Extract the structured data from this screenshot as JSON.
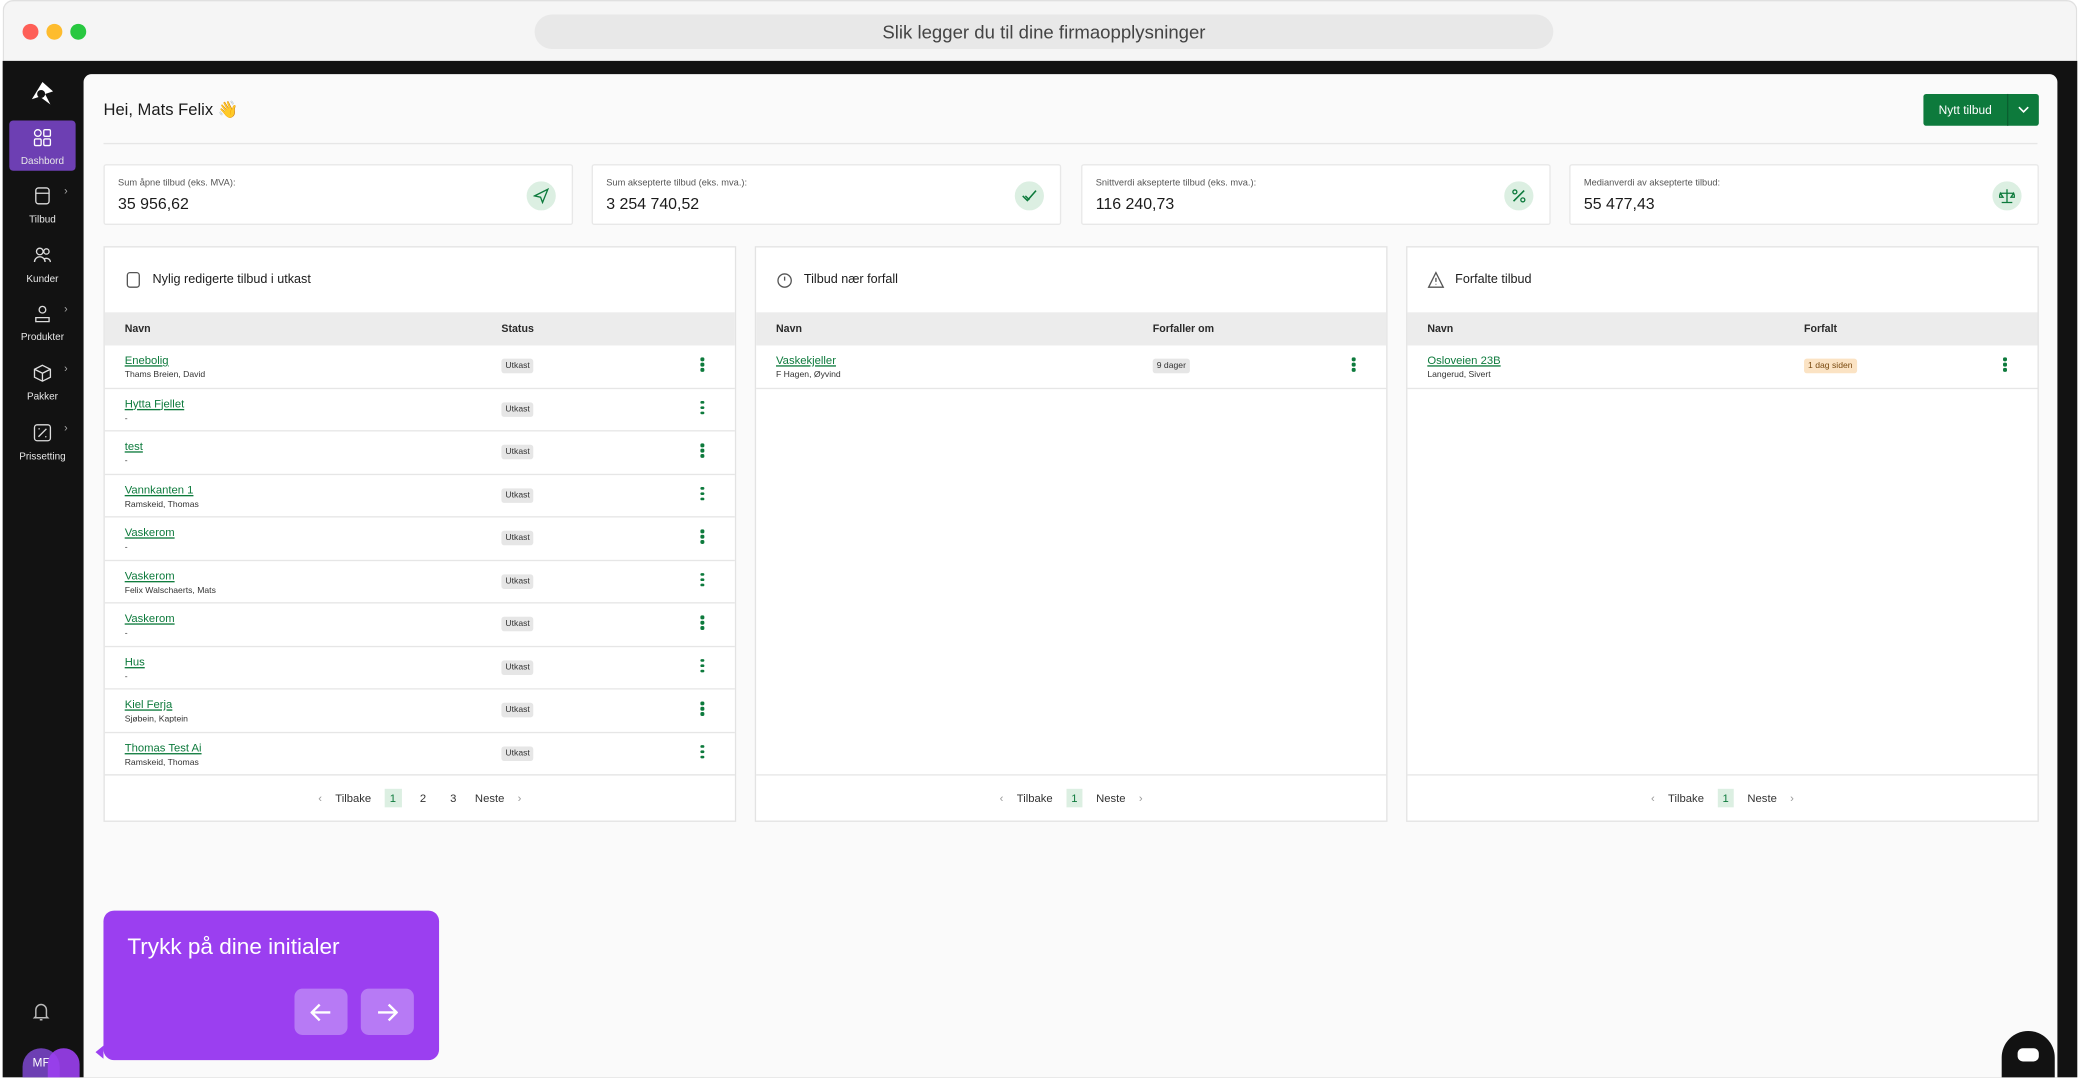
{
  "browser": {
    "url_title": "Slik legger du til dine firmaopplysninger"
  },
  "sidebar": {
    "items": [
      {
        "label": "Dashbord",
        "icon": "grid-icon",
        "active": true
      },
      {
        "label": "Tilbud",
        "icon": "calculator-icon"
      },
      {
        "label": "Kunder",
        "icon": "users-icon"
      },
      {
        "label": "Produkter",
        "icon": "user-box-icon"
      },
      {
        "label": "Pakker",
        "icon": "package-icon"
      },
      {
        "label": "Prissetting",
        "icon": "pricing-icon"
      }
    ],
    "avatar": "MF"
  },
  "header": {
    "greeting": "Hei, Mats Felix 👋",
    "new_button": "Nytt tilbud"
  },
  "stats": [
    {
      "label": "Sum åpne tilbud (eks. MVA):",
      "value": "35 956,62",
      "icon": "send-icon"
    },
    {
      "label": "Sum aksepterte tilbud (eks. mva.):",
      "value": "3 254 740,52",
      "icon": "check-icon"
    },
    {
      "label": "Snittverdi aksepterte tilbud (eks. mva.):",
      "value": "116 240,73",
      "icon": "percent-icon"
    },
    {
      "label": "Medianverdi av aksepterte tilbud:",
      "value": "55 477,43",
      "icon": "scale-icon"
    }
  ],
  "panels": {
    "drafts": {
      "title": "Nylig redigerte tilbud i utkast",
      "col_name": "Navn",
      "col_status": "Status",
      "rows": [
        {
          "name": "Enebolig",
          "sub": "Thams Breien, David",
          "status": "Utkast"
        },
        {
          "name": "Hytta Fjellet",
          "sub": "-",
          "status": "Utkast"
        },
        {
          "name": "test",
          "sub": "-",
          "status": "Utkast"
        },
        {
          "name": "Vannkanten 1",
          "sub": "Ramskeid, Thomas",
          "status": "Utkast"
        },
        {
          "name": "Vaskerom",
          "sub": "-",
          "status": "Utkast"
        },
        {
          "name": "Vaskerom",
          "sub": "Felix Walschaerts, Mats",
          "status": "Utkast"
        },
        {
          "name": "Vaskerom",
          "sub": "-",
          "status": "Utkast"
        },
        {
          "name": "Hus",
          "sub": "-",
          "status": "Utkast"
        },
        {
          "name": "Kiel Ferja",
          "sub": "Sjøbein, Kaptein",
          "status": "Utkast"
        },
        {
          "name": "Thomas Test Ai",
          "sub": "Ramskeid, Thomas",
          "status": "Utkast"
        }
      ],
      "pager": {
        "prev": "Tilbake",
        "pages": [
          "1",
          "2",
          "3"
        ],
        "next": "Neste"
      }
    },
    "due_soon": {
      "title": "Tilbud nær forfall",
      "col_name": "Navn",
      "col_status": "Forfaller om",
      "rows": [
        {
          "name": "Vaskekjeller",
          "sub": "F Hagen, Øyvind",
          "status": "9 dager"
        }
      ],
      "pager": {
        "prev": "Tilbake",
        "pages": [
          "1"
        ],
        "next": "Neste"
      }
    },
    "overdue": {
      "title": "Forfalte tilbud",
      "col_name": "Navn",
      "col_status": "Forfalt",
      "rows": [
        {
          "name": "Osloveien 23B",
          "sub": "Langerud, Sivert",
          "status": "1 dag siden"
        }
      ],
      "pager": {
        "prev": "Tilbake",
        "pages": [
          "1"
        ],
        "next": "Neste"
      }
    }
  },
  "tour": {
    "text": "Trykk på dine initialer"
  },
  "colors": {
    "accent_green": "#0d7a3c",
    "sidebar_active": "#6d3fb3",
    "tour_purple": "#9b3ff0"
  }
}
